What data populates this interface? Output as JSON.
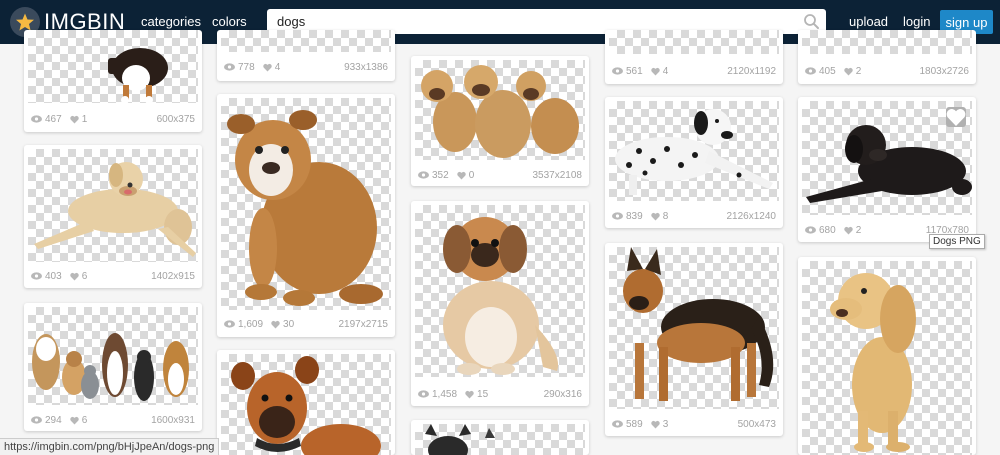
{
  "app": {
    "logo_text": "IMGBIN"
  },
  "header": {
    "nav": {
      "categories": "categories",
      "colors": "colors"
    },
    "search": {
      "value": "dogs",
      "placeholder": ""
    },
    "upload": "upload",
    "login": "login",
    "signup": "sign up"
  },
  "colors": {
    "header_bg": "#0c2236",
    "accent": "#1e88c8",
    "star": "#f5b942"
  },
  "cards": [
    {
      "views": "467",
      "likes": "1",
      "dims": "600x375",
      "subject": "dog-partial"
    },
    {
      "views": "403",
      "likes": "6",
      "dims": "1402x915",
      "subject": "labrador"
    },
    {
      "views": "294",
      "likes": "6",
      "dims": "1600x931",
      "subject": "dog-group"
    },
    {
      "views": "778",
      "likes": "4",
      "dims": "933x1386",
      "subject": ""
    },
    {
      "views": "1,609",
      "likes": "30",
      "dims": "2197x2715",
      "subject": "bulldog"
    },
    {
      "views": "",
      "likes": "",
      "dims": "",
      "subject": "boxer"
    },
    {
      "views": "352",
      "likes": "0",
      "dims": "3537x2108",
      "subject": "shar-pei-puppies"
    },
    {
      "views": "1,458",
      "likes": "15",
      "dims": "290x316",
      "subject": "pekingese"
    },
    {
      "views": "",
      "likes": "",
      "dims": "",
      "subject": "french-bulldogs"
    },
    {
      "views": "561",
      "likes": "4",
      "dims": "2120x1192",
      "subject": ""
    },
    {
      "views": "839",
      "likes": "8",
      "dims": "2126x1240",
      "subject": "dalmatian"
    },
    {
      "views": "589",
      "likes": "3",
      "dims": "500x473",
      "subject": "german-shepherd"
    },
    {
      "views": "405",
      "likes": "2",
      "dims": "1803x2726",
      "subject": ""
    },
    {
      "views": "680",
      "likes": "2",
      "dims": "1170x780",
      "subject": "newfoundland"
    },
    {
      "views": "",
      "likes": "",
      "dims": "",
      "subject": "cocker-spaniel"
    }
  ],
  "tooltip": "Dogs PNG",
  "status_url": "https://imgbin.com/png/bHjJpeAn/dogs-png"
}
